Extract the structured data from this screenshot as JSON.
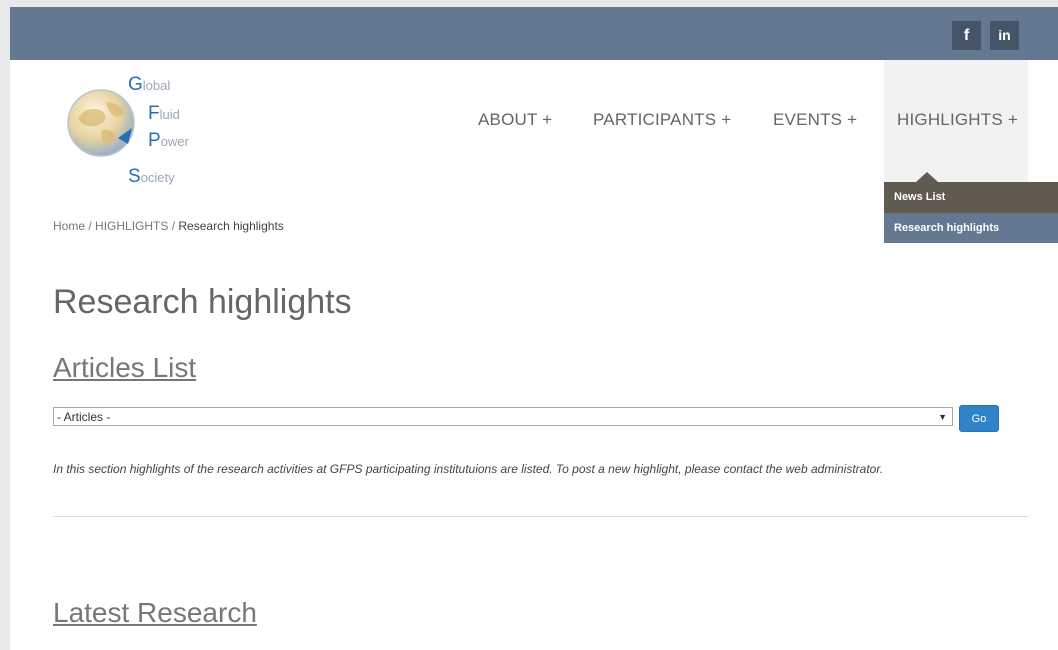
{
  "header": {
    "social": {
      "facebook": "f",
      "linkedin": "in"
    }
  },
  "logo": {
    "lines": [
      {
        "cap": "G",
        "rest": "lobal"
      },
      {
        "cap": "F",
        "rest": "luid"
      },
      {
        "cap": "P",
        "rest": "ower"
      },
      {
        "cap": "S",
        "rest": "ociety"
      }
    ]
  },
  "nav": {
    "items": [
      {
        "label": "ABOUT +"
      },
      {
        "label": "PARTICIPANTS +"
      },
      {
        "label": "EVENTS +"
      },
      {
        "label": "HIGHLIGHTS +"
      }
    ],
    "dropdown": [
      {
        "label": "News List"
      },
      {
        "label": "Research highlights"
      }
    ]
  },
  "breadcrumb": {
    "home": "Home",
    "sep": " / ",
    "section": "HIGHLIGHTS",
    "current": "Research highlights"
  },
  "main": {
    "title": "Research highlights",
    "articles_title": "Articles List",
    "select_value": "- Articles -",
    "go_label": "Go",
    "intro": "In this section highlights of the research activities at GFPS participating institutuions are listed. To post a new highlight, please contact the web administrator.",
    "latest_title": "Latest Research"
  },
  "colors": {
    "topbar": "#647891",
    "social_bg": "#455569",
    "dropdown_active": "#615a51",
    "dropdown_item": "#647891",
    "go_button": "#3083c9"
  }
}
